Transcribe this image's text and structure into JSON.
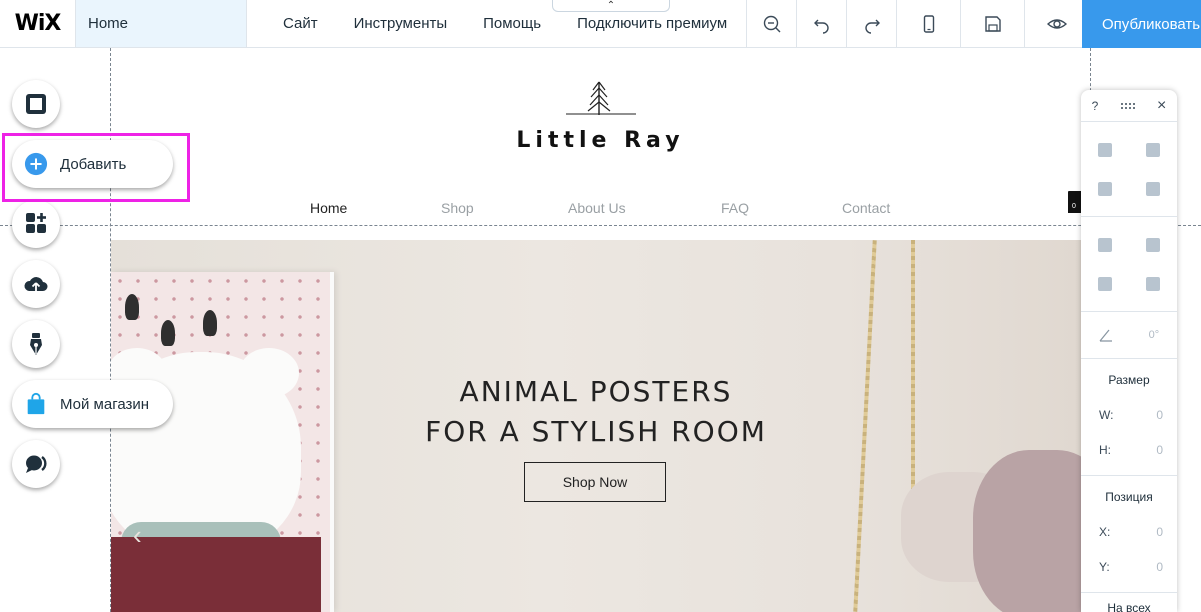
{
  "topbar": {
    "logo": "WiX",
    "page_selector": "Home",
    "menu": [
      {
        "label": "Сайт"
      },
      {
        "label": "Инструменты"
      },
      {
        "label": "Помощь"
      },
      {
        "label": "Подключить премиум"
      }
    ],
    "collapse_glyph": "⌃",
    "tools": [
      "zoom-out-icon",
      "undo-icon",
      "redo-icon",
      "mobile-view-icon",
      "save-icon",
      "preview-icon"
    ],
    "publish_label": "Опубликовать"
  },
  "left_toolbar": {
    "add_label": "Добавить",
    "store_label": "Мой магазин"
  },
  "site": {
    "title": "Little Ray",
    "nav": [
      "Home",
      "Shop",
      "About Us",
      "FAQ",
      "Contact"
    ],
    "cart_count": "0",
    "hero_line1": "ANIMAL POSTERS",
    "hero_line2": "FOR A STYLISH ROOM",
    "hero_button": "Shop Now",
    "hero_prev": "‹"
  },
  "right_panel": {
    "help": "?",
    "close": "×",
    "angle_value": "0°",
    "size_label": "Размер",
    "w_label": "W:",
    "h_label": "H:",
    "w_value": "0",
    "h_value": "0",
    "position_label": "Позиция",
    "x_label": "X:",
    "y_label": "Y:",
    "x_value": "0",
    "y_value": "0",
    "all_pages": "На всех страницах"
  },
  "colors": {
    "accent": "#3899ec",
    "highlight": "#ee22e6",
    "page_selector_bg": "#eaf5fd"
  }
}
